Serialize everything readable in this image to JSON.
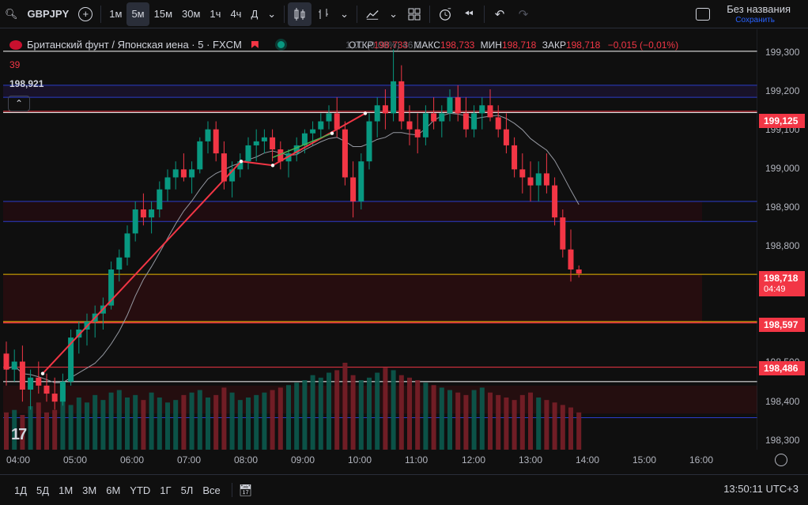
{
  "toolbar": {
    "symbol": "GBPJPY",
    "intervals": [
      "1м",
      "5м",
      "15м",
      "30м",
      "1ч",
      "4ч",
      "Д"
    ],
    "active_interval": "5м",
    "layout_name": "Без названия",
    "layout_status": "Сохранить"
  },
  "legend": {
    "title": "Британский фунт / Японская иена · 5 · FXCM",
    "open_label": "ОТКР",
    "open_value": "198,733",
    "high_label": "МАКС",
    "high_value": "198,733",
    "low_label": "МИН",
    "low_value": "198,718",
    "close_label": "ЗАКР",
    "close_value": "198,718",
    "change": "−0,015 (−0,01%)",
    "ghost_text": "1,00 (0,08%) 46,0",
    "countdown": "39",
    "volume": "198,921"
  },
  "price_axis": {
    "ticks": [
      "199,300",
      "199,200",
      "199,100",
      "199,000",
      "198,900",
      "198,800",
      "198,500",
      "198,400",
      "198,300"
    ],
    "labels": [
      {
        "value": "199,125",
        "style": "red"
      },
      {
        "value": "198,718",
        "sub": "04:49",
        "style": "red"
      },
      {
        "value": "198,597",
        "style": "red"
      },
      {
        "value": "198,486",
        "style": "red"
      }
    ]
  },
  "time_axis": [
    "04:00",
    "05:00",
    "06:00",
    "07:00",
    "08:00",
    "09:00",
    "10:00",
    "11:00",
    "12:00",
    "13:00",
    "14:00",
    "15:00",
    "16:00"
  ],
  "bottom": {
    "ranges": [
      "1Д",
      "5Д",
      "1М",
      "3М",
      "6М",
      "YTD",
      "1Г",
      "5Л",
      "Все"
    ],
    "clock": "13:50:11 UTC+3"
  },
  "colors": {
    "up": "#089981",
    "down": "#f23645",
    "bg": "#0f0f0f"
  },
  "chart_data": {
    "type": "candlestick",
    "ylim": [
      198.28,
      199.33
    ],
    "candles": [
      [
        198.52,
        198.55,
        198.44,
        198.48
      ],
      [
        198.48,
        198.53,
        198.45,
        198.5
      ],
      [
        198.5,
        198.54,
        198.4,
        198.43
      ],
      [
        198.43,
        198.48,
        198.38,
        198.46
      ],
      [
        198.46,
        198.5,
        198.42,
        198.44
      ],
      [
        198.44,
        198.47,
        198.4,
        198.42
      ],
      [
        198.42,
        198.46,
        198.38,
        198.4
      ],
      [
        198.4,
        198.47,
        198.39,
        198.45
      ],
      [
        198.45,
        198.58,
        198.44,
        198.56
      ],
      [
        198.56,
        198.6,
        198.52,
        198.58
      ],
      [
        198.58,
        198.62,
        198.54,
        198.6
      ],
      [
        198.6,
        198.64,
        198.56,
        198.62
      ],
      [
        198.62,
        198.66,
        198.58,
        198.64
      ],
      [
        198.64,
        198.75,
        198.63,
        198.73
      ],
      [
        198.73,
        198.78,
        198.7,
        198.76
      ],
      [
        198.76,
        198.84,
        198.74,
        198.82
      ],
      [
        198.82,
        198.9,
        198.8,
        198.88
      ],
      [
        198.88,
        198.92,
        198.84,
        198.86
      ],
      [
        198.86,
        198.9,
        198.82,
        198.88
      ],
      [
        198.88,
        198.95,
        198.86,
        198.93
      ],
      [
        198.93,
        198.98,
        198.9,
        198.96
      ],
      [
        198.96,
        199.0,
        198.93,
        198.98
      ],
      [
        198.98,
        199.02,
        198.95,
        198.96
      ],
      [
        198.96,
        199.0,
        198.92,
        198.98
      ],
      [
        198.98,
        199.06,
        198.97,
        199.05
      ],
      [
        199.05,
        199.1,
        199.02,
        199.08
      ],
      [
        199.08,
        199.1,
        199.0,
        199.02
      ],
      [
        199.02,
        199.05,
        198.93,
        198.95
      ],
      [
        198.95,
        199.0,
        198.91,
        198.98
      ],
      [
        198.98,
        199.02,
        198.96,
        199.0
      ],
      [
        199.0,
        199.06,
        198.98,
        199.04
      ],
      [
        199.04,
        199.08,
        199.0,
        199.05
      ],
      [
        199.05,
        199.08,
        199.02,
        199.06
      ],
      [
        199.06,
        199.08,
        199.0,
        199.03
      ],
      [
        199.03,
        199.05,
        198.98,
        199.0
      ],
      [
        199.0,
        199.03,
        198.96,
        199.02
      ],
      [
        199.02,
        199.06,
        199.0,
        199.04
      ],
      [
        199.04,
        199.08,
        199.02,
        199.07
      ],
      [
        199.07,
        199.1,
        199.04,
        199.08
      ],
      [
        199.08,
        199.12,
        199.06,
        199.1
      ],
      [
        199.1,
        199.14,
        199.08,
        199.12
      ],
      [
        199.12,
        199.16,
        199.06,
        199.08
      ],
      [
        199.08,
        199.1,
        198.94,
        198.96
      ],
      [
        198.96,
        199.0,
        198.86,
        198.9
      ],
      [
        198.9,
        199.02,
        198.88,
        199.0
      ],
      [
        199.0,
        199.12,
        198.98,
        199.1
      ],
      [
        199.1,
        199.16,
        199.06,
        199.14
      ],
      [
        199.14,
        199.18,
        199.08,
        199.12
      ],
      [
        199.12,
        199.28,
        199.1,
        199.2
      ],
      [
        199.2,
        199.24,
        199.08,
        199.1
      ],
      [
        199.1,
        199.14,
        199.04,
        199.08
      ],
      [
        199.08,
        199.12,
        199.02,
        199.06
      ],
      [
        199.06,
        199.14,
        199.04,
        199.12
      ],
      [
        199.12,
        199.16,
        199.08,
        199.1
      ],
      [
        199.1,
        199.14,
        199.06,
        199.12
      ],
      [
        199.12,
        199.18,
        199.1,
        199.16
      ],
      [
        199.16,
        199.19,
        199.1,
        199.12
      ],
      [
        199.12,
        199.16,
        199.06,
        199.08
      ],
      [
        199.08,
        199.14,
        199.06,
        199.12
      ],
      [
        199.12,
        199.16,
        199.08,
        199.14
      ],
      [
        199.14,
        199.18,
        199.1,
        199.11
      ],
      [
        199.11,
        199.14,
        199.06,
        199.08
      ],
      [
        199.08,
        199.12,
        199.02,
        199.04
      ],
      [
        199.04,
        199.06,
        198.96,
        198.98
      ],
      [
        198.98,
        199.02,
        198.92,
        198.96
      ],
      [
        198.96,
        199.0,
        198.9,
        198.94
      ],
      [
        198.94,
        199.0,
        198.9,
        198.97
      ],
      [
        198.97,
        199.02,
        198.92,
        198.94
      ],
      [
        198.94,
        198.96,
        198.84,
        198.86
      ],
      [
        198.86,
        198.88,
        198.76,
        198.78
      ],
      [
        198.78,
        198.83,
        198.7,
        198.73
      ],
      [
        198.73,
        198.74,
        198.71,
        198.72
      ]
    ],
    "volumes": [
      30,
      32,
      28,
      35,
      38,
      30,
      32,
      40,
      36,
      42,
      38,
      44,
      40,
      46,
      48,
      42,
      44,
      40,
      46,
      42,
      38,
      40,
      44,
      46,
      48,
      42,
      44,
      50,
      46,
      40,
      42,
      44,
      46,
      48,
      50,
      52,
      54,
      56,
      60,
      58,
      62,
      64,
      70,
      60,
      56,
      58,
      62,
      66,
      64,
      60,
      58,
      56,
      54,
      52,
      50,
      48,
      46,
      44,
      48,
      50,
      46,
      44,
      42,
      40,
      44,
      46,
      42,
      40,
      38,
      36,
      34,
      30
    ]
  }
}
